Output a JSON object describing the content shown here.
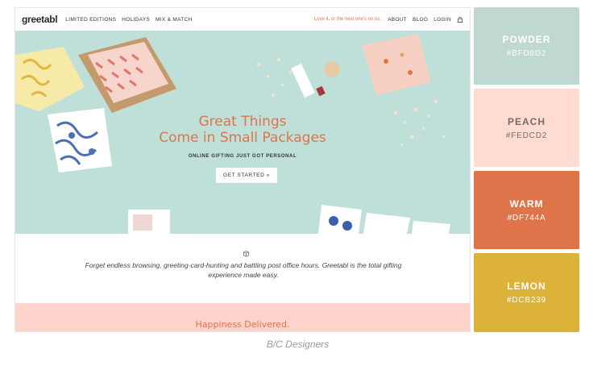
{
  "site": {
    "logo": "greetabl",
    "nav": [
      "LIMITED EDITIONS",
      "HOLIDAYS",
      "MIX & MATCH"
    ],
    "tagline": "Love it, or the next one's on us.",
    "nav_right": [
      "ABOUT",
      "BLOG",
      "LOGIN"
    ],
    "hero_title_line1": "Great Things",
    "hero_title_line2": "Come in Small Packages",
    "hero_subtitle": "ONLINE GIFTING JUST GOT PERSONAL",
    "cta_label": "GET STARTED »",
    "info_text_line1": "Forget endless browsing, greeting-card-hunting and battling post office hours. Greetabl is the total gifting",
    "info_text_line2": "experience made easy.",
    "band_title": "Happiness Delivered."
  },
  "swatches": [
    {
      "name": "POWDER",
      "hex": "#BFD8D2",
      "color": "#bfd8d2"
    },
    {
      "name": "PEACH",
      "hex": "#FEDCD2",
      "color": "#fedcd2"
    },
    {
      "name": "WARM",
      "hex": "#DF744A",
      "color": "#df744a"
    },
    {
      "name": "LEMON",
      "hex": "#DCB239",
      "color": "#dcb239"
    }
  ],
  "caption": "B/C Designers"
}
